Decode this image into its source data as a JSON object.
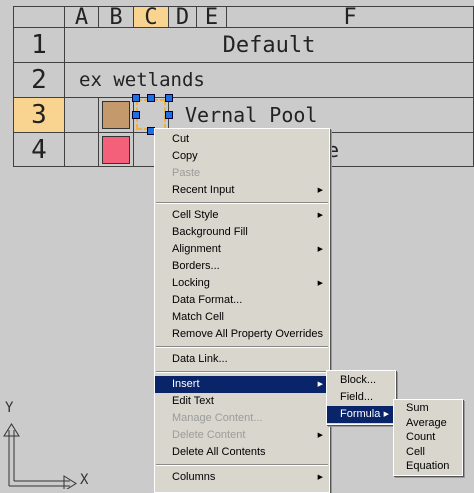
{
  "columns": [
    "A",
    "B",
    "C",
    "D",
    "E",
    "F"
  ],
  "rows": [
    {
      "num": "1",
      "text": "Default"
    },
    {
      "num": "2",
      "text": "ex wetlands"
    },
    {
      "num": "3",
      "text": "Vernal Pool",
      "swatch": "#c49a6c"
    },
    {
      "num": "4",
      "text": "e",
      "swatch": "#f4607a"
    }
  ],
  "context_menu": {
    "items": [
      {
        "label": "Cut"
      },
      {
        "label": "Copy"
      },
      {
        "label": "Paste"
      },
      {
        "label": "Recent Input"
      },
      {
        "label": "Cell Style"
      },
      {
        "label": "Background Fill"
      },
      {
        "label": "Alignment"
      },
      {
        "label": "Borders..."
      },
      {
        "label": "Locking"
      },
      {
        "label": "Data Format..."
      },
      {
        "label": "Match Cell"
      },
      {
        "label": "Remove All Property Overrides"
      },
      {
        "label": "Data Link..."
      },
      {
        "label": "Insert"
      },
      {
        "label": "Edit Text"
      },
      {
        "label": "Manage Content..."
      },
      {
        "label": "Delete Content"
      },
      {
        "label": "Delete All Contents"
      },
      {
        "label": "Columns"
      }
    ]
  },
  "insert_submenu": [
    "Block...",
    "Field...",
    "Formula"
  ],
  "formula_submenu": [
    "Sum",
    "Average",
    "Count",
    "Cell",
    "Equation"
  ],
  "axis": {
    "x": "X",
    "y": "Y"
  },
  "colors": {
    "highlight": "#f9d490",
    "menu_selection": "#0a246a"
  }
}
